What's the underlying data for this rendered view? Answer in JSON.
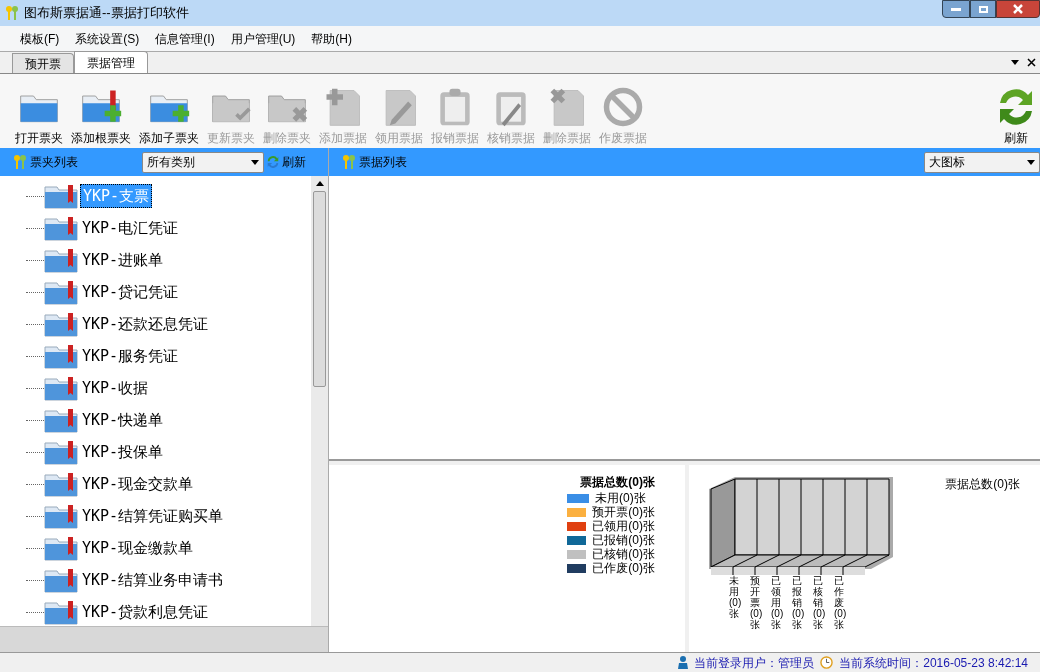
{
  "window": {
    "title": "图布斯票据通--票据打印软件"
  },
  "menu": [
    "模板(F)",
    "系统设置(S)",
    "信息管理(I)",
    "用户管理(U)",
    "帮助(H)"
  ],
  "tabs": [
    {
      "label": "预开票",
      "selected": false
    },
    {
      "label": "票据管理",
      "selected": true
    }
  ],
  "toolbar": [
    {
      "label": "打开票夹",
      "kind": "folder",
      "disabled": false
    },
    {
      "label": "添加根票夹",
      "kind": "bookmark",
      "disabled": false
    },
    {
      "label": "添加子票夹",
      "kind": "subfolder",
      "disabled": false
    },
    {
      "label": "更新票夹",
      "kind": "update",
      "disabled": true
    },
    {
      "label": "删除票夹",
      "kind": "remove",
      "disabled": true
    },
    {
      "label": "添加票据",
      "kind": "add",
      "disabled": true
    },
    {
      "label": "领用票据",
      "kind": "pencil",
      "disabled": true
    },
    {
      "label": "报销票据",
      "kind": "clipboard",
      "disabled": true
    },
    {
      "label": "核销票据",
      "kind": "pen",
      "disabled": true
    },
    {
      "label": "删除票据",
      "kind": "delete",
      "disabled": true
    },
    {
      "label": "作废票据",
      "kind": "ban",
      "disabled": true
    }
  ],
  "refresh_button": "刷新",
  "folder_panel": {
    "title": "票夹列表",
    "filter": "所有类别",
    "refresh": "刷新",
    "items": [
      {
        "label": "YKP-支票",
        "selected": true
      },
      {
        "label": "YKP-电汇凭证",
        "selected": false
      },
      {
        "label": "YKP-进账单",
        "selected": false
      },
      {
        "label": "YKP-贷记凭证",
        "selected": false
      },
      {
        "label": "YKP-还款还息凭证",
        "selected": false
      },
      {
        "label": "YKP-服务凭证",
        "selected": false
      },
      {
        "label": "YKP-收据",
        "selected": false
      },
      {
        "label": "YKP-快递单",
        "selected": false
      },
      {
        "label": "YKP-投保单",
        "selected": false
      },
      {
        "label": "YKP-现金交款单",
        "selected": false
      },
      {
        "label": "YKP-结算凭证购买单",
        "selected": false
      },
      {
        "label": "YKP-现金缴款单",
        "selected": false
      },
      {
        "label": "YKP-结算业务申请书",
        "selected": false
      },
      {
        "label": "YKP-贷款利息凭证",
        "selected": false
      }
    ]
  },
  "ticket_panel": {
    "title": "票据列表",
    "view": "大图标"
  },
  "legend": {
    "title": "票据总数(0)张",
    "items": [
      {
        "label": "未用(0)张",
        "color": "#3a8ee6"
      },
      {
        "label": "预开票(0)张",
        "color": "#fbb040"
      },
      {
        "label": "已领用(0)张",
        "color": "#e04010"
      },
      {
        "label": "已报销(0)张",
        "color": "#106898"
      },
      {
        "label": "已核销(0)张",
        "color": "#c0c0c0"
      },
      {
        "label": "已作废(0)张",
        "color": "#203c60"
      }
    ]
  },
  "bar_chart": {
    "title": "票据总数(0)张",
    "labels": [
      "未用(0)张",
      "预开票(0)张",
      "已领用(0)张",
      "已报销(0)张",
      "已核销(0)张",
      "已作废(0)张"
    ]
  },
  "status_bar": {
    "user": "当前登录用户：管理员",
    "time": "当前系统时间：2016-05-23 8:42:14"
  }
}
